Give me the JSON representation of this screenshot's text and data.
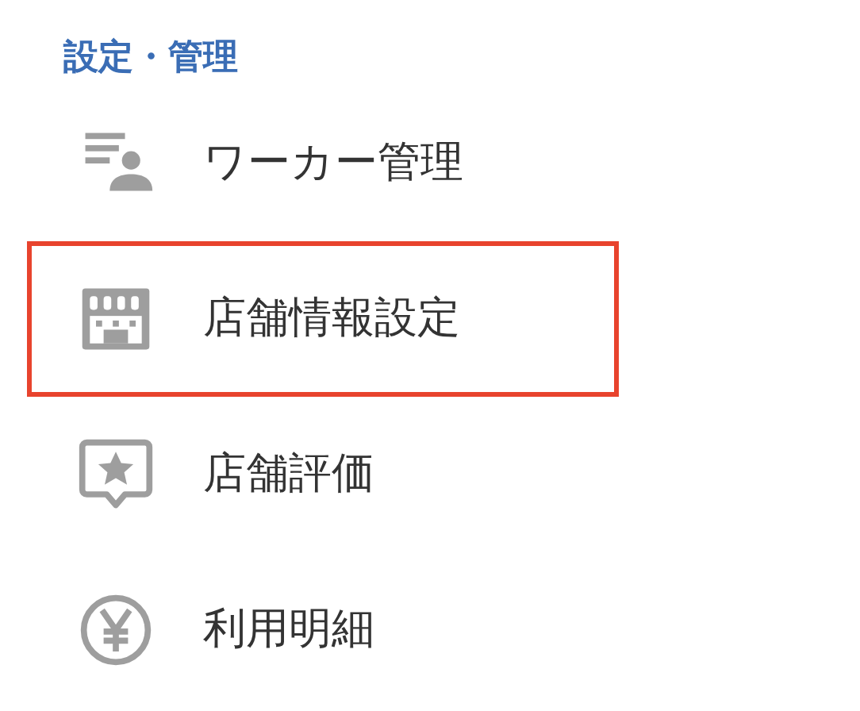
{
  "section": {
    "title": "設定・管理"
  },
  "items": [
    {
      "kind": "workers",
      "label": "ワーカー管理",
      "highlighted": false
    },
    {
      "kind": "store",
      "label": "店舗情報設定",
      "highlighted": true
    },
    {
      "kind": "rating",
      "label": "店舗評価",
      "highlighted": false
    },
    {
      "kind": "yen",
      "label": "利用明細",
      "highlighted": false
    }
  ]
}
